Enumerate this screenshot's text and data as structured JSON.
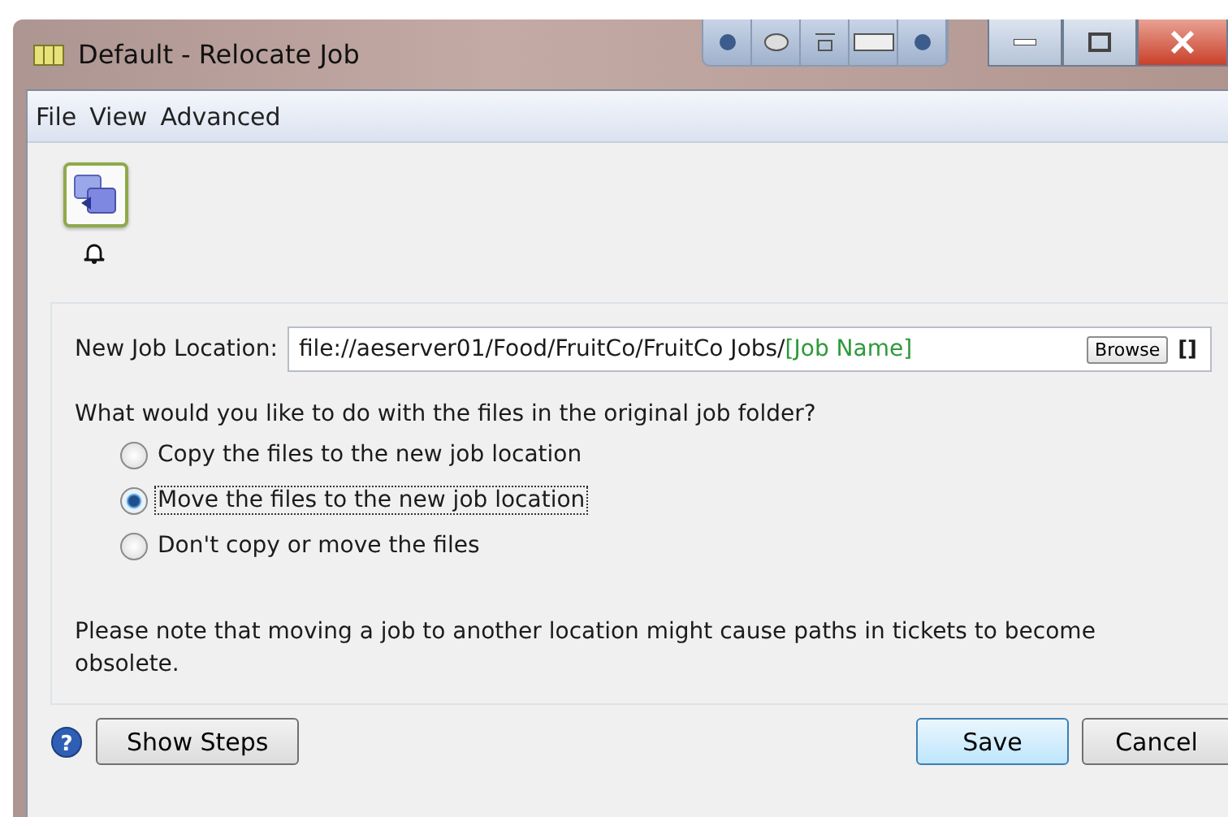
{
  "window": {
    "title": "Default - Relocate Job"
  },
  "menu": [
    "File",
    "View",
    "Advanced"
  ],
  "location": {
    "label": "New Job Location:",
    "path": "file://aeserver01/Food/FruitCo/FruitCo Jobs/",
    "token": "[Job Name]",
    "browse": "Browse",
    "brackets": "[]"
  },
  "question": "What would you like to do with the files in the original job folder?",
  "options": [
    {
      "label": "Copy the files to the new job location",
      "selected": false
    },
    {
      "label": "Move the files to the new job location",
      "selected": true
    },
    {
      "label": "Don't copy or move the files",
      "selected": false
    }
  ],
  "note": "Please note that moving a job to another location might cause paths in tickets to become obsolete.",
  "buttons": {
    "help": "?",
    "steps": "Show Steps",
    "save": "Save",
    "cancel": "Cancel"
  }
}
